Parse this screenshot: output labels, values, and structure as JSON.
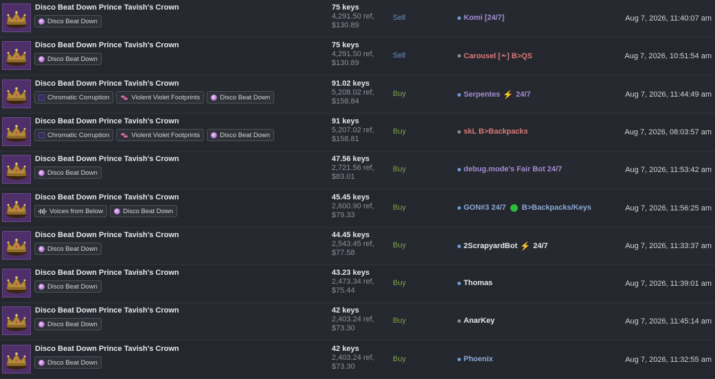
{
  "colors": {
    "thumb_bg": "#4f2f6a",
    "sell": "#6a8fbf",
    "buy": "#7ea34a",
    "dot_blue": "#6a9fe0",
    "dot_gray": "#8a8d92",
    "trader_purple": "#a58bd2",
    "trader_red": "#d97878",
    "trader_blue": "#8da8d6",
    "trader_white": "#e8e8ea"
  },
  "listings": [
    {
      "item": "Disco Beat Down Prince Tavish's Crown",
      "tags": [
        {
          "icon": "disco-icon",
          "label": "Disco Beat Down"
        }
      ],
      "keys": "75 keys",
      "ref": "4,291.50 ref,",
      "usd": "$130.89",
      "intent": "Sell",
      "trader": {
        "dot": "#6a9fe0",
        "name": "Komi [24/7]",
        "color": "#a58bd2"
      },
      "date": "Aug 7, 2026, 11:40:07 am"
    },
    {
      "item": "Disco Beat Down Prince Tavish's Crown",
      "tags": [
        {
          "icon": "disco-icon",
          "label": "Disco Beat Down"
        }
      ],
      "keys": "75 keys",
      "ref": "4,291.50 ref,",
      "usd": "$130.89",
      "intent": "Sell",
      "trader": {
        "dot": "#8a8d92",
        "name": "Carousel [⩪] B>QS",
        "color": "#d97878"
      },
      "date": "Aug 7, 2026, 10:51:54 am"
    },
    {
      "item": "Disco Beat Down Prince Tavish's Crown",
      "tags": [
        {
          "icon": "chromatic-icon",
          "label": "Chromatic Corruption"
        },
        {
          "icon": "footprints-icon",
          "label": "Violent Violet Footprints"
        },
        {
          "icon": "disco-icon",
          "label": "Disco Beat Down"
        }
      ],
      "keys": "91.02 keys",
      "ref": "5,208.02 ref,",
      "usd": "$158.84",
      "intent": "Buy",
      "trader": {
        "dot": "#6a9fe0",
        "name": "Serpentes",
        "bolt": "⚡",
        "suffix": "24/7",
        "color": "#a58bd2"
      },
      "date": "Aug 7, 2026, 11:44:49 am"
    },
    {
      "item": "Disco Beat Down Prince Tavish's Crown",
      "tags": [
        {
          "icon": "chromatic-icon",
          "label": "Chromatic Corruption"
        },
        {
          "icon": "footprints-icon",
          "label": "Violent Violet Footprints"
        },
        {
          "icon": "disco-icon",
          "label": "Disco Beat Down"
        }
      ],
      "keys": "91 keys",
      "ref": "5,207.02 ref,",
      "usd": "$158.81",
      "intent": "Buy",
      "trader": {
        "dot": "#8a8d92",
        "name": "skL B>Backpacks",
        "color": "#d97878"
      },
      "date": "Aug 7, 2026, 08:03:57 am"
    },
    {
      "item": "Disco Beat Down Prince Tavish's Crown",
      "tags": [
        {
          "icon": "disco-icon",
          "label": "Disco Beat Down"
        }
      ],
      "keys": "47.56 keys",
      "ref": "2,721.56 ref,",
      "usd": "$83.01",
      "intent": "Buy",
      "trader": {
        "dot": "#6a9fe0",
        "name": "debug.mode's Fair Bot 24/7",
        "color": "#a58bd2"
      },
      "date": "Aug 7, 2026, 11:53:42 am"
    },
    {
      "item": "Disco Beat Down Prince Tavish's Crown",
      "tags": [
        {
          "icon": "voices-icon",
          "label": "Voices from Below"
        },
        {
          "icon": "disco-icon",
          "label": "Disco Beat Down"
        }
      ],
      "keys": "45.45 keys",
      "ref": "2,600.90 ref,",
      "usd": "$79.33",
      "intent": "Buy",
      "trader": {
        "dot": "#6a9fe0",
        "name": "GON#3 24/7",
        "circle": true,
        "suffix": "B>Backpacks/Keys",
        "color": "#8da8d6"
      },
      "date": "Aug 7, 2026, 11:56:25 am"
    },
    {
      "item": "Disco Beat Down Prince Tavish's Crown",
      "tags": [
        {
          "icon": "disco-icon",
          "label": "Disco Beat Down"
        }
      ],
      "keys": "44.45 keys",
      "ref": "2,543.45 ref,",
      "usd": "$77.58",
      "intent": "Buy",
      "trader": {
        "dot": "#6a9fe0",
        "name": "2ScrapyardBot",
        "bolt": "⚡",
        "suffix": "24/7",
        "color": "#e8e8ea"
      },
      "date": "Aug 7, 2026, 11:33:37 am"
    },
    {
      "item": "Disco Beat Down Prince Tavish's Crown",
      "tags": [
        {
          "icon": "disco-icon",
          "label": "Disco Beat Down"
        }
      ],
      "keys": "43.23 keys",
      "ref": "2,473.34 ref,",
      "usd": "$75.44",
      "intent": "Buy",
      "trader": {
        "dot": "#6a9fe0",
        "name": "Thomas",
        "color": "#e8e8ea"
      },
      "date": "Aug 7, 2026, 11:39:01 am"
    },
    {
      "item": "Disco Beat Down Prince Tavish's Crown",
      "tags": [
        {
          "icon": "disco-icon",
          "label": "Disco Beat Down"
        }
      ],
      "keys": "42 keys",
      "ref": "2,403.24 ref,",
      "usd": "$73.30",
      "intent": "Buy",
      "trader": {
        "dot": "#8a8d92",
        "name": "AnarKey",
        "color": "#e8e8ea"
      },
      "date": "Aug 7, 2026, 11:45:14 am"
    },
    {
      "item": "Disco Beat Down Prince Tavish's Crown",
      "tags": [
        {
          "icon": "disco-icon",
          "label": "Disco Beat Down"
        }
      ],
      "keys": "42 keys",
      "ref": "2,403.24 ref,",
      "usd": "$73.30",
      "intent": "Buy",
      "trader": {
        "dot": "#6a9fe0",
        "name": "Phoenix",
        "color": "#8da8d6"
      },
      "date": "Aug 7, 2026, 11:32:55 am"
    }
  ]
}
